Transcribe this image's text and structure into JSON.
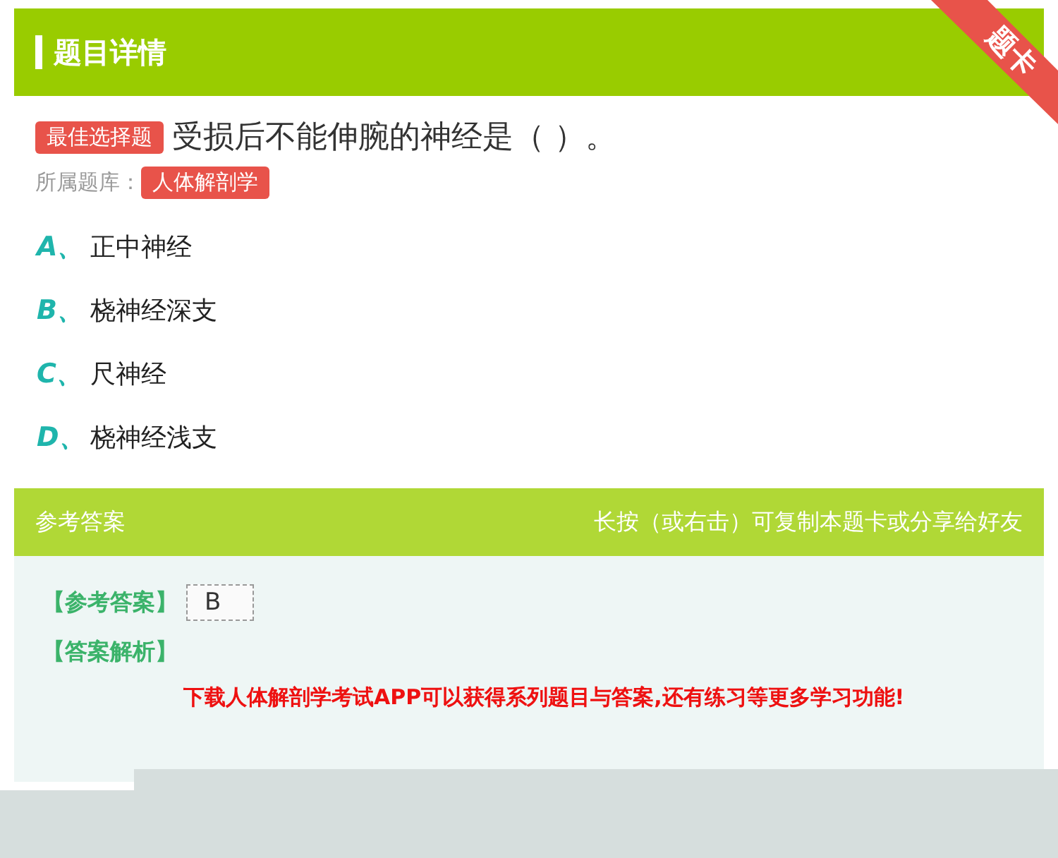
{
  "header": {
    "title": "题目详情",
    "ribbon": "题卡"
  },
  "question": {
    "type_tag": "最佳选择题",
    "text": "受损后不能伸腕的神经是（ ）。",
    "bank_label": "所属题库：",
    "bank": "人体解剖学"
  },
  "options": [
    {
      "letter": "A",
      "sep": "、",
      "text": "正中神经"
    },
    {
      "letter": "B",
      "sep": "、",
      "text": "桡神经深支"
    },
    {
      "letter": "C",
      "sep": "、",
      "text": "尺神经"
    },
    {
      "letter": "D",
      "sep": "、",
      "text": "桡神经浅支"
    }
  ],
  "answer": {
    "title": "参考答案",
    "hint": "长按（或右击）可复制本题卡或分享给好友",
    "answer_label": "【参考答案】",
    "answer_value": "B",
    "analysis_label": "【答案解析】",
    "promo": "下载人体解剖学考试APP可以获得系列题目与答案,还有练习等更多学习功能!"
  }
}
